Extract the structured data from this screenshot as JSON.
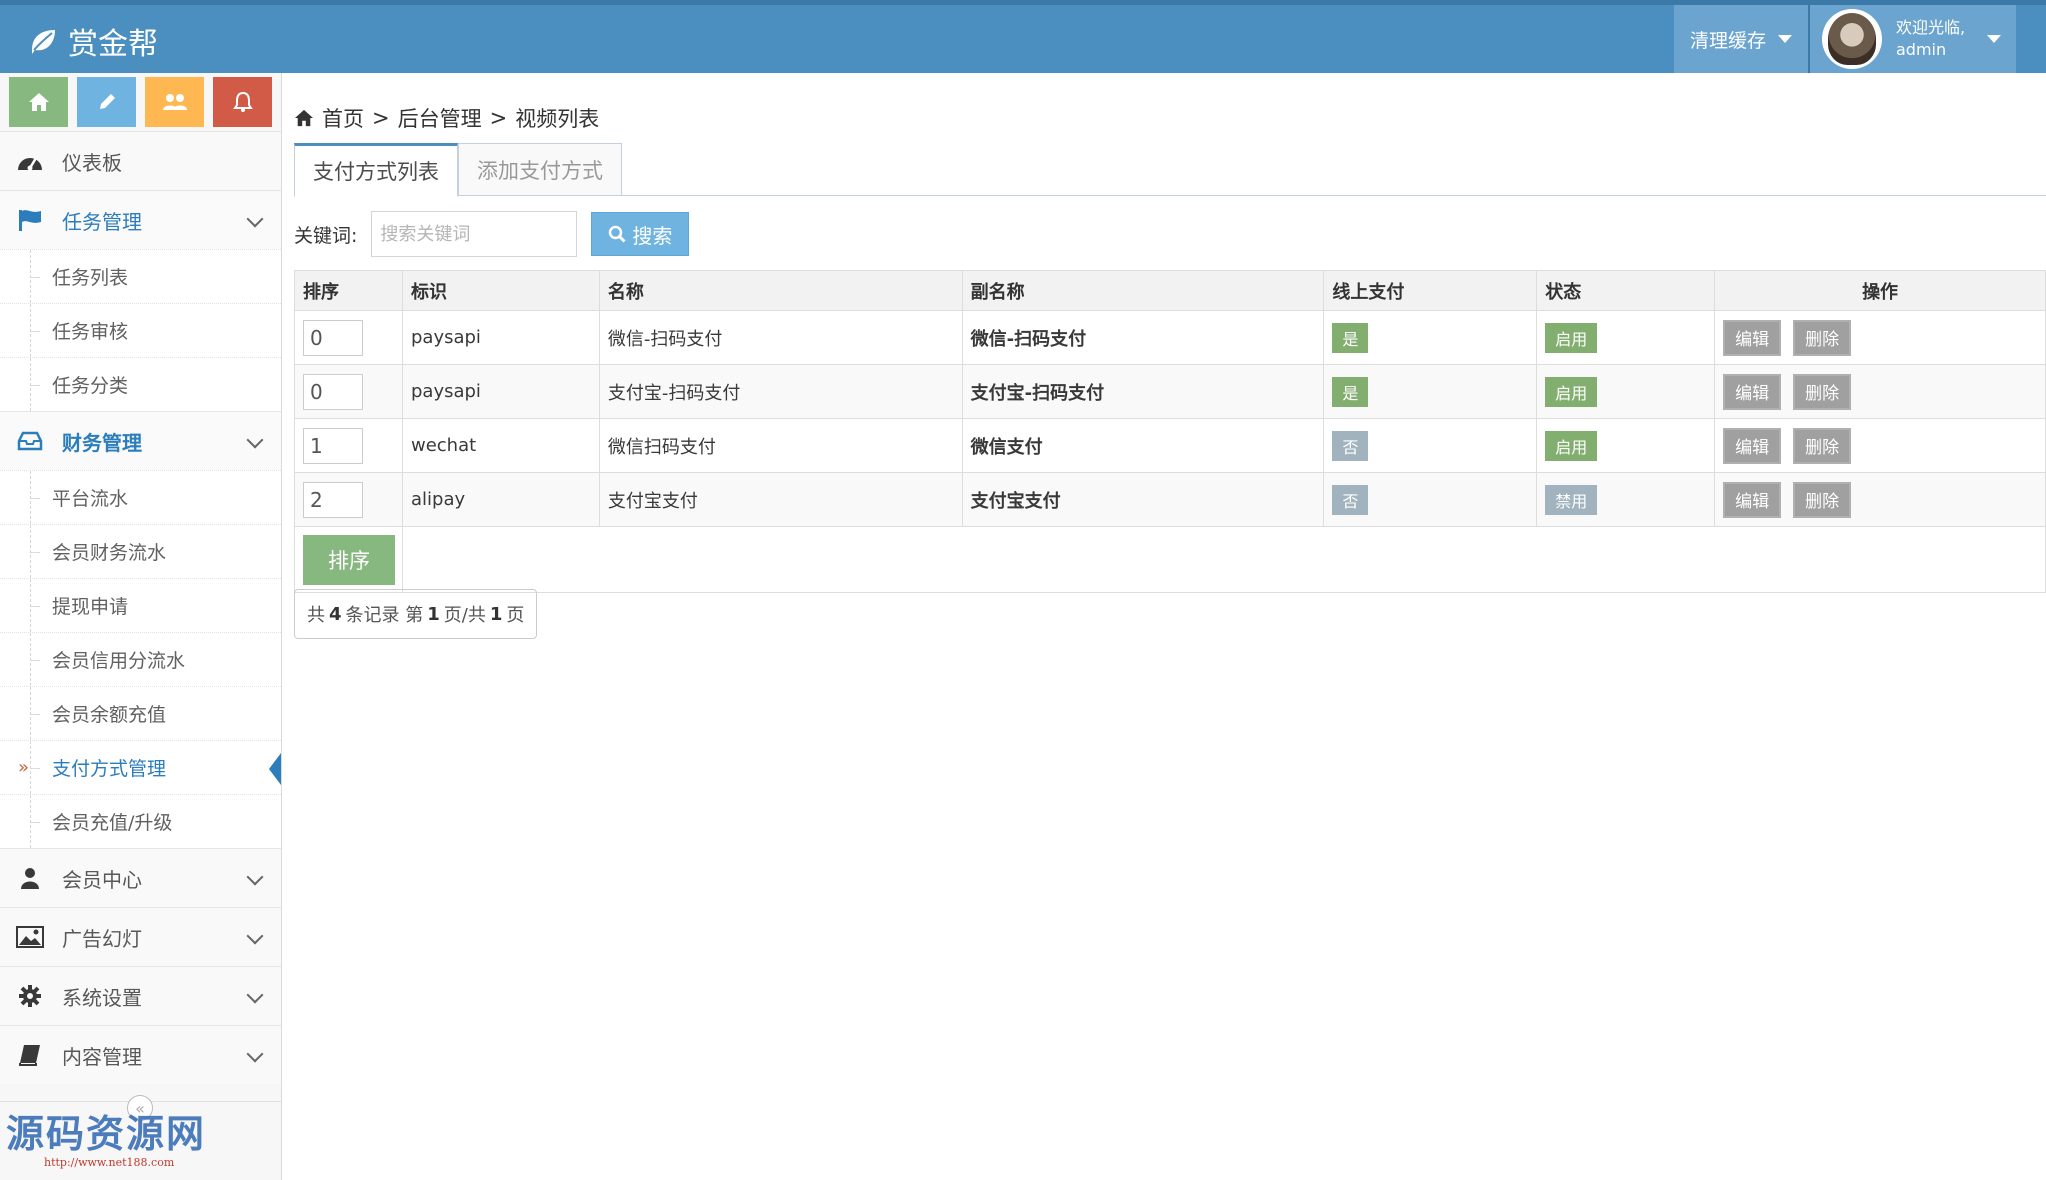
{
  "app": {
    "title": "赏金帮"
  },
  "header": {
    "clear_cache": "清理缓存",
    "welcome": "欢迎光临,",
    "username": "admin"
  },
  "shortcuts": [
    {
      "icon": "home-icon",
      "color": "#87b87f"
    },
    {
      "icon": "pencil-icon",
      "color": "#6fb3e0"
    },
    {
      "icon": "users-icon",
      "color": "#ffb752"
    },
    {
      "icon": "bell-icon",
      "color": "#d15b47"
    }
  ],
  "sidebar": {
    "dashboard": "仪表板",
    "task_mgmt": "任务管理",
    "task_items": [
      "任务列表",
      "任务审核",
      "任务分类"
    ],
    "finance_mgmt": "财务管理",
    "finance_items": [
      "平台流水",
      "会员财务流水",
      "提现申请",
      "会员信用分流水",
      "会员余额充值",
      "支付方式管理",
      "会员充值/升级"
    ],
    "member_center": "会员中心",
    "ad_slides": "广告幻灯",
    "system_settings": "系统设置",
    "content_mgmt": "内容管理",
    "collapse": "«"
  },
  "watermark": {
    "main": "源码资源网",
    "url": "http://www.net188.com"
  },
  "breadcrumb": {
    "home": "首页",
    "sep1": ">",
    "admin": "后台管理",
    "sep2": ">",
    "current": "视频列表"
  },
  "tabs": {
    "list": "支付方式列表",
    "add": "添加支付方式"
  },
  "search": {
    "label": "关键词:",
    "placeholder": "搜索关键词",
    "button": "搜索"
  },
  "table": {
    "headers": [
      "排序",
      "标识",
      "名称",
      "副名称",
      "线上支付",
      "状态",
      "操作"
    ],
    "rows": [
      {
        "sort": "0",
        "key": "paysapi",
        "name": "微信-扫码支付",
        "subname": "微信-扫码支付",
        "online": "是",
        "status": "启用",
        "edit": "编辑",
        "del": "删除"
      },
      {
        "sort": "0",
        "key": "paysapi",
        "name": "支付宝-扫码支付",
        "subname": "支付宝-扫码支付",
        "online": "是",
        "status": "启用",
        "edit": "编辑",
        "del": "删除"
      },
      {
        "sort": "1",
        "key": "wechat",
        "name": "微信扫码支付",
        "subname": "微信支付",
        "online": "否",
        "status": "启用",
        "edit": "编辑",
        "del": "删除"
      },
      {
        "sort": "2",
        "key": "alipay",
        "name": "支付宝支付",
        "subname": "支付宝支付",
        "online": "否",
        "status": "禁用",
        "edit": "编辑",
        "del": "删除"
      }
    ],
    "sort_button": "排序"
  },
  "pager": {
    "p1": "共",
    "total": "4",
    "p2": "条记录 第",
    "page": "1",
    "p3": "页/共",
    "pages": "1",
    "p4": "页"
  }
}
